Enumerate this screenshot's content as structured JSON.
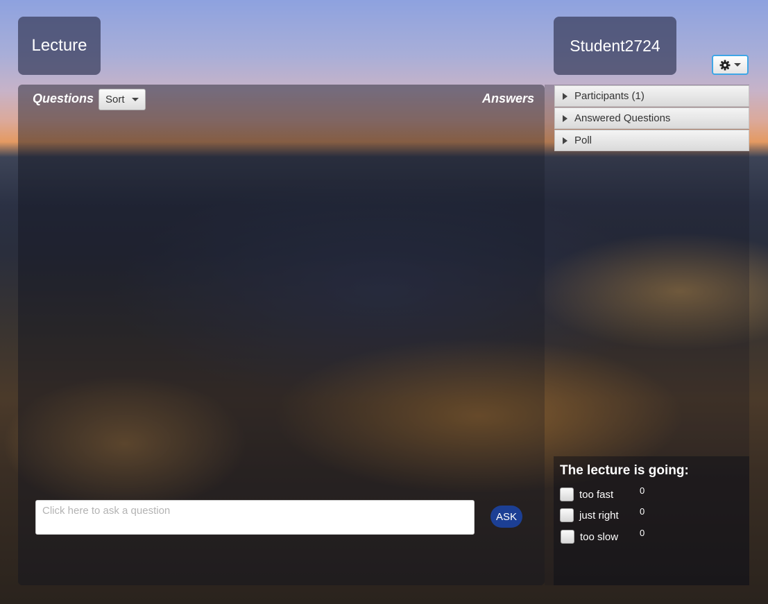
{
  "header": {
    "lecture_label": "Lecture",
    "student_name": "Student2724"
  },
  "toolbar": {
    "settings_icon": "gear-icon",
    "dropdown_icon": "chevron-down-icon"
  },
  "questions_panel": {
    "questions_heading": "Questions",
    "sort_label": "Sort",
    "answers_heading": "Answers"
  },
  "sidebar": {
    "items": [
      {
        "label": "Participants (1)"
      },
      {
        "label": "Answered Questions"
      },
      {
        "label": "Poll"
      }
    ]
  },
  "ask": {
    "placeholder": "Click here to ask a question",
    "value": "",
    "button_label": "ASK"
  },
  "pace": {
    "title": "The lecture is going:",
    "options": [
      {
        "label": "too fast",
        "count": "0"
      },
      {
        "label": "just right",
        "count": "0"
      },
      {
        "label": "too slow",
        "count": "0"
      }
    ]
  },
  "colors": {
    "ask_button": "#1c3f94",
    "focus_ring": "#3ea6e6"
  }
}
